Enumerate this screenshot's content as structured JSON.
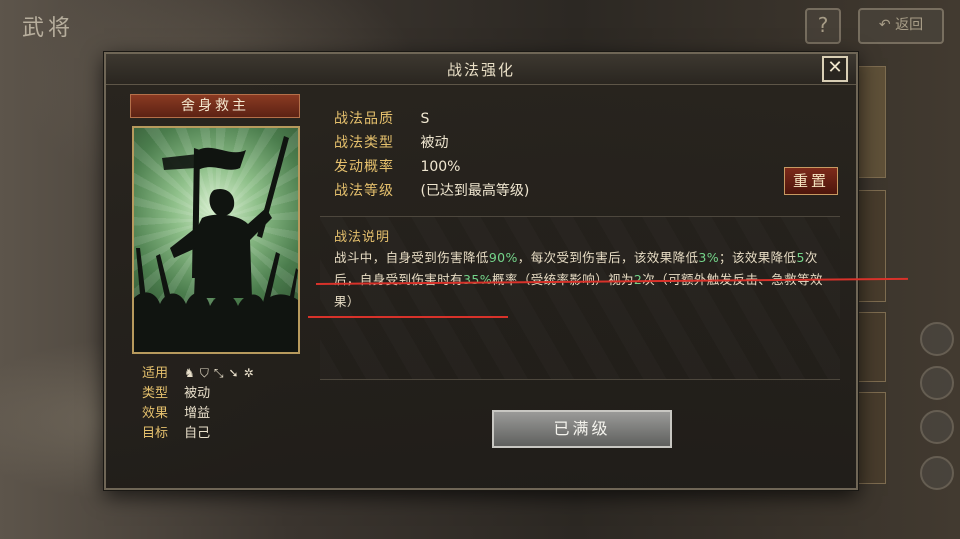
{
  "background": {
    "screen_title": "武将",
    "help_label": "?",
    "back_label": "返回"
  },
  "dialog": {
    "title": "战法强化",
    "close_label": "✕"
  },
  "skill": {
    "name": "舍身救主",
    "attributes": [
      {
        "label": "适用",
        "value": "",
        "icons": [
          "cavalry-icon",
          "shield-icon",
          "bow-icon",
          "spear-icon",
          "wheel-icon"
        ]
      },
      {
        "label": "类型",
        "value": "被动"
      },
      {
        "label": "效果",
        "value": "增益"
      },
      {
        "label": "目标",
        "value": "自己"
      }
    ]
  },
  "info": {
    "quality_label": "战法品质",
    "quality_value": "S",
    "type_label": "战法类型",
    "type_value": "被动",
    "rate_label": "发动概率",
    "rate_value": "100%",
    "level_label": "战法等级",
    "level_value": "(已达到最高等级)"
  },
  "reset_label": "重置",
  "description": {
    "title": "战法说明",
    "parts": [
      {
        "text": "战斗中，自身受到伤害降低",
        "hl": false
      },
      {
        "text": "90%",
        "hl": true
      },
      {
        "text": "，每次受到伤害后，该效果降低",
        "hl": false
      },
      {
        "text": "3%",
        "hl": true
      },
      {
        "text": "；该效果降低",
        "hl": false
      },
      {
        "text": "5",
        "hl": true
      },
      {
        "text": "次后，自身受到伤害时有",
        "hl": false
      },
      {
        "text": "35%",
        "hl": true
      },
      {
        "text": "概率（受统率影响）视为",
        "hl": false
      },
      {
        "text": "2",
        "hl": true
      },
      {
        "text": "次（可额外触发反击、急救等效果）",
        "hl": false
      }
    ]
  },
  "max_level_label": "已满级",
  "colors": {
    "accent_gold": "#e5c06d",
    "highlight_green": "#74d48a",
    "annotation_red": "#d8322a"
  }
}
